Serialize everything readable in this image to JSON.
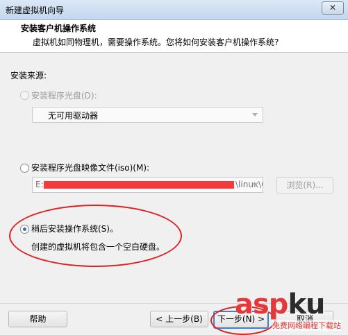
{
  "window": {
    "title": "新建虚拟机向导",
    "close_label": "✕"
  },
  "header": {
    "title": "安装客户机操作系统",
    "subtitle": "虚拟机如同物理机，需要操作系统。您将如何安装客户机操作系统?"
  },
  "install_source": {
    "label": "安装来源:",
    "optical_disc": {
      "label": "安装程序光盘(D):",
      "selected": false,
      "enabled": false,
      "dropdown_value": "无可用驱动器"
    },
    "iso_file": {
      "label": "安装程序光盘映像文件(iso)(M):",
      "selected": false,
      "path_prefix": "E:",
      "path_suffix": "\\linux\\CentO",
      "browse_label": "浏览(R)..."
    },
    "install_later": {
      "label": "稍后安装操作系统(S)。",
      "selected": true,
      "description": "创建的虚拟机将包含一个空白硬盘。"
    }
  },
  "footer": {
    "help_label": "帮助",
    "back_label": "< 上一步(B)",
    "next_label": "下一步(N) >",
    "cancel_label": "取消"
  },
  "watermark": {
    "main_a": "asp",
    "main_b": "ku",
    "sub": "免费网络编程下载站"
  },
  "colors": {
    "accent": "#3c7fd0",
    "annotation": "#e02020",
    "redaction": "#f23c3c"
  }
}
